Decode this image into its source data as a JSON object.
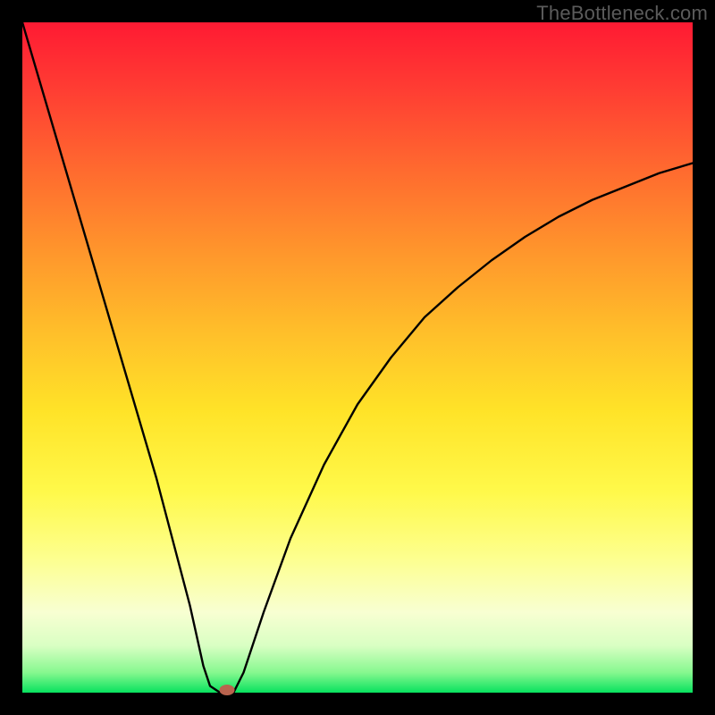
{
  "watermark": "TheBottleneck.com",
  "chart_data": {
    "type": "line",
    "title": "",
    "xlabel": "",
    "ylabel": "",
    "xlim": [
      0,
      100
    ],
    "ylim": [
      0,
      100
    ],
    "grid": false,
    "legend": false,
    "series": [
      {
        "name": "bottleneck-curve",
        "x": [
          0,
          5,
          10,
          15,
          20,
          25,
          27,
          28,
          29.5,
          31.5,
          33,
          36,
          40,
          45,
          50,
          55,
          60,
          65,
          70,
          75,
          80,
          85,
          90,
          95,
          100
        ],
        "values": [
          100,
          83,
          66,
          49,
          32,
          13,
          4,
          1,
          0,
          0,
          3,
          12,
          23,
          34,
          43,
          50,
          56,
          60.5,
          64.5,
          68,
          71,
          73.5,
          75.5,
          77.5,
          79
        ]
      }
    ],
    "marker": {
      "x": 30.5,
      "y": 0
    },
    "gradient": {
      "direction": "vertical",
      "stops": [
        {
          "pos": 0,
          "color": "#ff1a33"
        },
        {
          "pos": 50,
          "color": "#ffe328"
        },
        {
          "pos": 100,
          "color": "#08e25e"
        }
      ]
    }
  }
}
